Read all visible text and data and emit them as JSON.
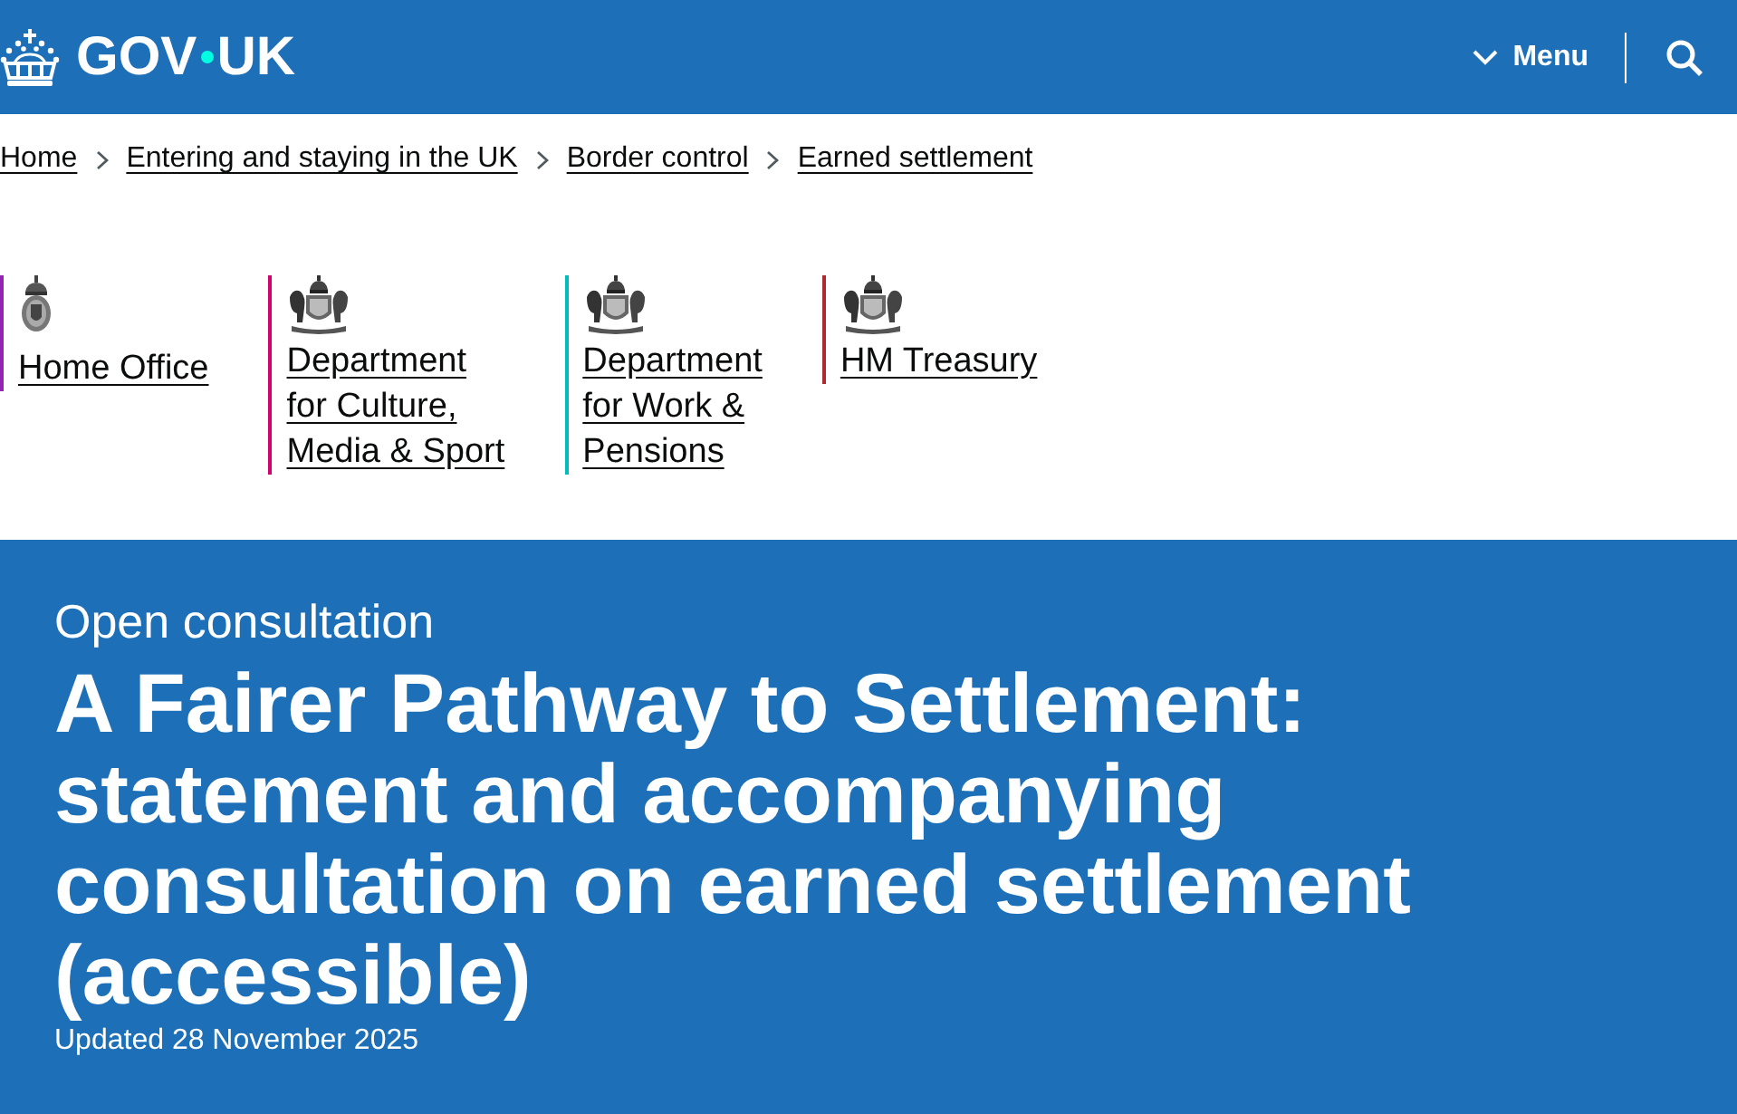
{
  "header": {
    "logo": {
      "words": [
        "GOV",
        "UK"
      ]
    },
    "menu": {
      "label": "Menu",
      "expanded": false
    }
  },
  "breadcrumbs": [
    "Home",
    "Entering and staying in the UK",
    "Border control",
    "Earned settlement"
  ],
  "organisations": [
    {
      "kind": "badge",
      "name_lines": [
        "Home Office"
      ],
      "color": "#9325b2"
    },
    {
      "kind": "arms",
      "name_lines": [
        "Department",
        "for Culture,",
        "Media & Sport"
      ],
      "color": "#d40072"
    },
    {
      "kind": "arms",
      "name_lines": [
        "Department",
        "for Work &",
        "Pensions"
      ],
      "color": "#00beb7"
    },
    {
      "kind": "arms",
      "name_lines": [
        "HM Treasury"
      ],
      "color": "#af292e"
    }
  ],
  "hero": {
    "document_type": "Open consultation",
    "title": "A Fairer Pathway to Settlement: statement and accompanying consultation on earned settlement (accessible)",
    "updated": "Updated 28 November 2025"
  }
}
